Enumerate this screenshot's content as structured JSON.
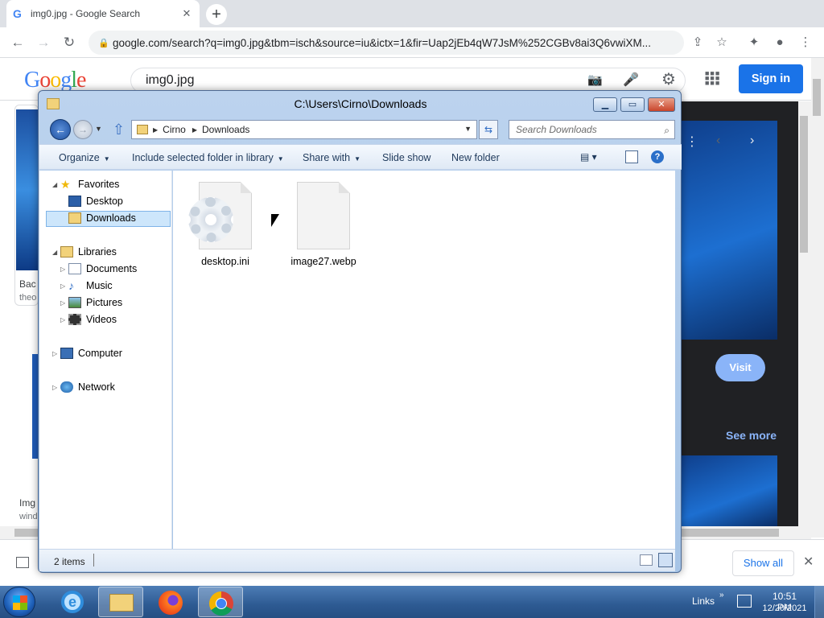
{
  "browser": {
    "tab_title": "img0.jpg - Google Search",
    "tab_favicon": "G",
    "tab_close": "✕",
    "newtab": "+",
    "url": "google.com/search?q=img0.jpg&tbm=isch&source=iu&ictx=1&fir=Uap2jEb4qW7JsM%252CGBv8ai3Q6vwiXM...",
    "nav": {
      "back": "←",
      "forward": "→",
      "reload": "↻"
    },
    "toolbar_icons": {
      "share": "⇪",
      "bookmark": "☆",
      "extensions": "✦",
      "profile": "●",
      "menu": "⋮"
    }
  },
  "google": {
    "logo": "Google",
    "logo_colors": [
      "#4285f4",
      "#ea4335",
      "#fbbc05",
      "#4285f4",
      "#34a853",
      "#ea4335"
    ],
    "query": "img0.jpg",
    "sign_in": "Sign in",
    "apps_icon": "⋮⋮⋮",
    "settings_icon": "⚙",
    "camera_icon": "📷",
    "mic_icon": "🎤",
    "left_results": [
      {
        "title": "Bac",
        "source": "theo"
      },
      {
        "title": "Img",
        "source": "wind"
      }
    ],
    "panel": {
      "visit": "Visit",
      "see_more": "See more",
      "dots": "⋮",
      "prev": "‹",
      "next": "›"
    },
    "show_all": "Show all",
    "dl_close": "✕"
  },
  "explorer": {
    "title": "C:\\Users\\Cirno\\Downloads",
    "caption": {
      "minimize": "▁",
      "maximize": "▭",
      "close": "✕"
    },
    "back": "←",
    "forward": "→",
    "history": "▼",
    "up": "⇧",
    "breadcrumb": [
      "Cirno",
      "Downloads"
    ],
    "breadcrumb_arrow": "▶",
    "address_dropdown": "▼",
    "refresh": "⇆",
    "search_placeholder": "Search Downloads",
    "search_icon": "⌕",
    "commands": {
      "organize": "Organize",
      "include": "Include selected folder in library",
      "share": "Share with",
      "slideshow": "Slide show",
      "newfolder": "New folder",
      "caret": "▼"
    },
    "view_icon": "▤ ▾",
    "help": "?",
    "nav": {
      "favorites": "Favorites",
      "desktop": "Desktop",
      "downloads": "Downloads",
      "libraries": "Libraries",
      "documents": "Documents",
      "music": "Music",
      "pictures": "Pictures",
      "videos": "Videos",
      "computer": "Computer",
      "network": "Network",
      "expanded": "◢",
      "collapsed": "▷"
    },
    "files": [
      {
        "name": "desktop.ini"
      },
      {
        "name": "image27.webp"
      }
    ],
    "status": "2 items"
  },
  "taskbar": {
    "links": "Links",
    "links_arrow": "»",
    "time": "10:51 PM",
    "date": "12/20/2021",
    "ie_glyph": "e"
  }
}
